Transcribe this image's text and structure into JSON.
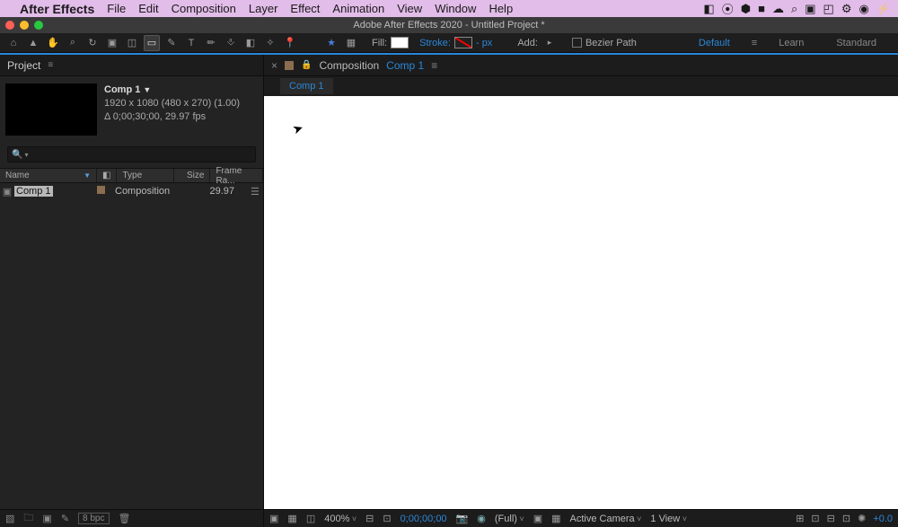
{
  "mac": {
    "app_name": "After Effects",
    "menus": [
      "File",
      "Edit",
      "Composition",
      "Layer",
      "Effect",
      "Animation",
      "View",
      "Window",
      "Help"
    ]
  },
  "window": {
    "title": "Adobe After Effects 2020 - Untitled Project *"
  },
  "toolbar": {
    "fill_label": "Fill:",
    "stroke_label": "Stroke:",
    "stroke_px": "-  px",
    "add_label": "Add:",
    "bezier_label": "Bezier Path"
  },
  "workspaces": {
    "default": "Default",
    "learn": "Learn",
    "standard": "Standard"
  },
  "project": {
    "tab": "Project",
    "comp_name": "Comp 1",
    "dims": "1920 x 1080  (480 x 270) (1.00)",
    "duration": "Δ 0;00;30;00, 29.97 fps",
    "cols": {
      "name": "Name",
      "type": "Type",
      "size": "Size",
      "framerate": "Frame Ra..."
    },
    "row": {
      "name": "Comp 1",
      "type": "Composition",
      "framerate": "29.97"
    },
    "bpc": "8 bpc"
  },
  "viewer": {
    "tab_label": "Composition",
    "comp_name": "Comp 1",
    "breadcrumb": "Comp 1"
  },
  "viewer_footer": {
    "zoom": "400%",
    "time": "0;00;00;00",
    "res": "(Full)",
    "camera": "Active Camera",
    "views": "1 View",
    "exposure": "+0.0"
  }
}
